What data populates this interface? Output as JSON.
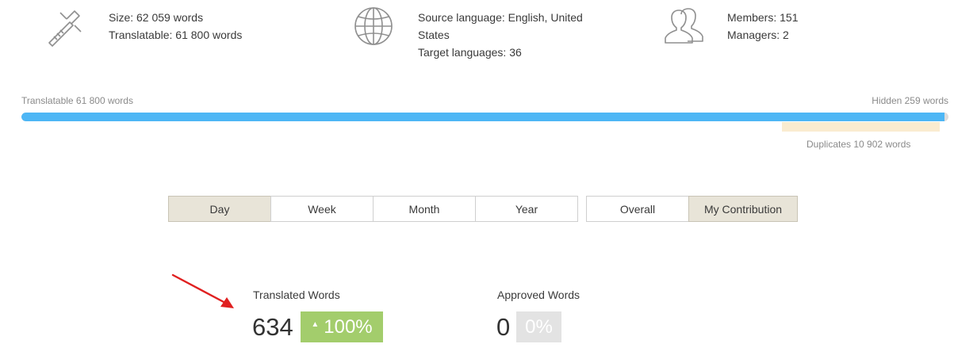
{
  "project_info": {
    "size": {
      "icon": "caliper-icon",
      "line1": "Size: 62 059 words",
      "line2": "Translatable: 61 800 words"
    },
    "languages": {
      "icon": "globe-icon",
      "line1": "Source language: English, United",
      "line2": "States",
      "line3": "Target languages: 36"
    },
    "members": {
      "icon": "users-icon",
      "line1": "Members: 151",
      "line2": "Managers: 2"
    }
  },
  "progress": {
    "translatable_label": "Translatable 61 800 words",
    "hidden_label": "Hidden 259 words",
    "duplicates_label": "Duplicates 10 902 words",
    "translatable_fraction": 0.9958,
    "colors": {
      "fill": "#4db6f5",
      "track": "#dcdcdc",
      "duplicates": "#faecd0"
    }
  },
  "period_tabs": [
    {
      "label": "Day",
      "active": true
    },
    {
      "label": "Week",
      "active": false
    },
    {
      "label": "Month",
      "active": false
    },
    {
      "label": "Year",
      "active": false
    }
  ],
  "scope_tabs": [
    {
      "label": "Overall",
      "active": false
    },
    {
      "label": "My Contribution",
      "active": true
    }
  ],
  "stats": {
    "translated": {
      "label": "Translated Words",
      "value": "634",
      "change": "100%",
      "trend": "up",
      "trend_icon": "triangle-up-icon",
      "color": "#a3cd6c"
    },
    "approved": {
      "label": "Approved Words",
      "value": "0",
      "change": "0%",
      "color": "#e3e3e3"
    }
  },
  "annotation": {
    "icon": "red-arrow-icon",
    "color": "#e02020"
  }
}
